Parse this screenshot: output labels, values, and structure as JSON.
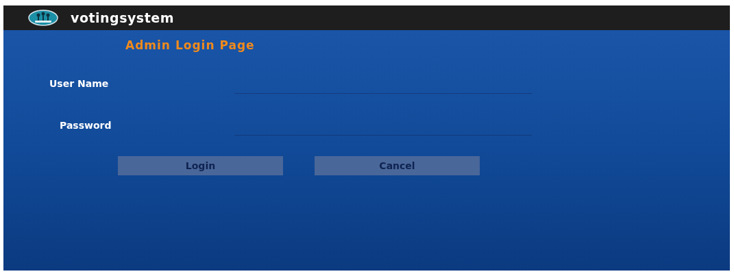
{
  "app_bar": {
    "title": "votingsystem"
  },
  "heading": "Admin Login Page",
  "fields": [
    {
      "label": "User Name"
    },
    {
      "label": "Password"
    }
  ],
  "buttons": [
    "Login",
    "Cancel"
  ]
}
